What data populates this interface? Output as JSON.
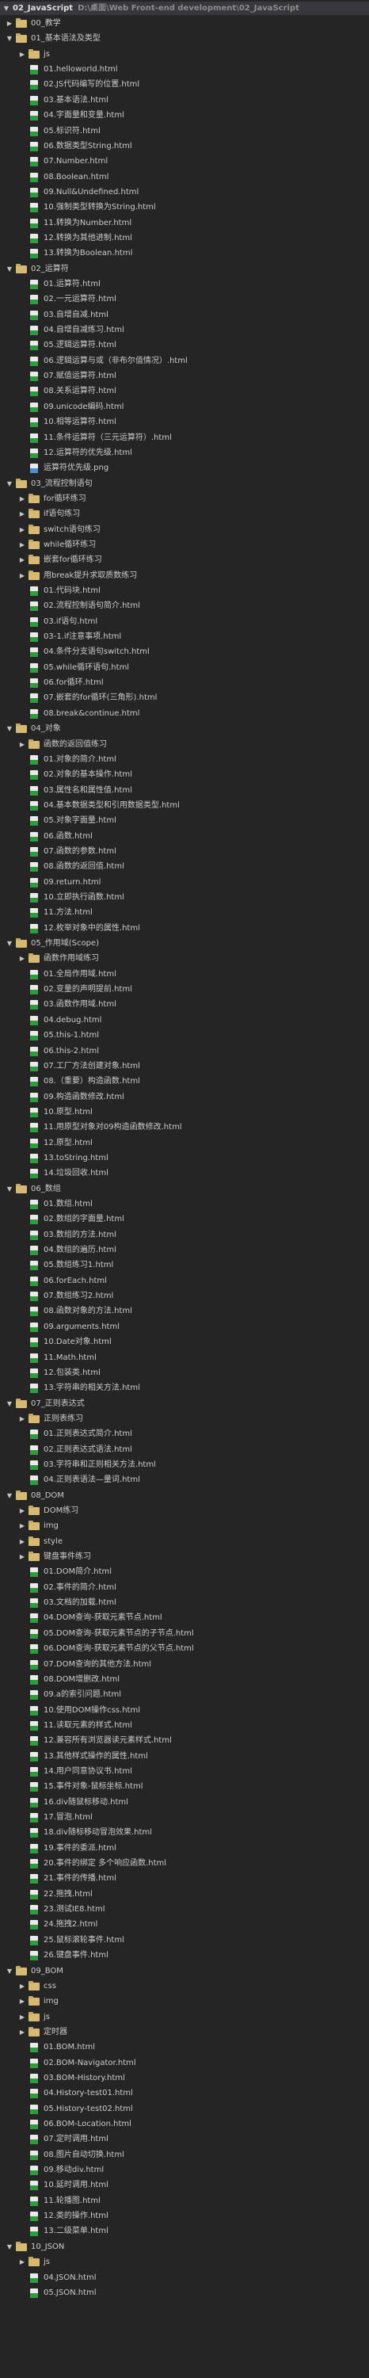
{
  "root": {
    "label": "02_JavaScript",
    "path": "D:\\桌面\\Web Front-end development\\02_JavaScript"
  },
  "items": [
    {
      "d": 1,
      "t": "folder",
      "n": "00_教学",
      "o": false
    },
    {
      "d": 1,
      "t": "folder",
      "n": "01_基本语法及类型",
      "o": true
    },
    {
      "d": 2,
      "t": "folder",
      "n": "js",
      "o": false
    },
    {
      "d": 2,
      "t": "html",
      "n": "01.helloworld.html"
    },
    {
      "d": 2,
      "t": "html",
      "n": "02.JS代码编写的位置.html"
    },
    {
      "d": 2,
      "t": "html",
      "n": "03.基本语法.html"
    },
    {
      "d": 2,
      "t": "html",
      "n": "04.字面量和变量.html"
    },
    {
      "d": 2,
      "t": "html",
      "n": "05.标识符.html"
    },
    {
      "d": 2,
      "t": "html",
      "n": "06.数据类型String.html"
    },
    {
      "d": 2,
      "t": "html",
      "n": "07.Number.html"
    },
    {
      "d": 2,
      "t": "html",
      "n": "08.Boolean.html"
    },
    {
      "d": 2,
      "t": "html",
      "n": "09.Null&Undefined.html"
    },
    {
      "d": 2,
      "t": "html",
      "n": "10.强制类型转换为String.html"
    },
    {
      "d": 2,
      "t": "html",
      "n": "11.转换为Number.html"
    },
    {
      "d": 2,
      "t": "html",
      "n": "12.转换为其他进制.html"
    },
    {
      "d": 2,
      "t": "html",
      "n": "13.转换为Boolean.html"
    },
    {
      "d": 1,
      "t": "folder",
      "n": "02_运算符",
      "o": true
    },
    {
      "d": 2,
      "t": "html",
      "n": "01.运算符.html"
    },
    {
      "d": 2,
      "t": "html",
      "n": "02.一元运算符.html"
    },
    {
      "d": 2,
      "t": "html",
      "n": "03.自增自减.html"
    },
    {
      "d": 2,
      "t": "html",
      "n": "04.自增自减练习.html"
    },
    {
      "d": 2,
      "t": "html",
      "n": "05.逻辑运算符.html"
    },
    {
      "d": 2,
      "t": "html",
      "n": "06.逻辑运算与或（非布尔值情况）.html"
    },
    {
      "d": 2,
      "t": "html",
      "n": "07.赋值运算符.html"
    },
    {
      "d": 2,
      "t": "html",
      "n": "08.关系运算符.html"
    },
    {
      "d": 2,
      "t": "html",
      "n": "09.unicode编码.html"
    },
    {
      "d": 2,
      "t": "html",
      "n": "10.相等运算符.html"
    },
    {
      "d": 2,
      "t": "html",
      "n": "11.条件运算符（三元运算符）.html"
    },
    {
      "d": 2,
      "t": "html",
      "n": "12.运算符的优先级.html"
    },
    {
      "d": 2,
      "t": "png",
      "n": "运算符优先级.png"
    },
    {
      "d": 1,
      "t": "folder",
      "n": "03_流程控制语句",
      "o": true
    },
    {
      "d": 2,
      "t": "folder",
      "n": "for循环练习",
      "o": false
    },
    {
      "d": 2,
      "t": "folder",
      "n": "if语句练习",
      "o": false
    },
    {
      "d": 2,
      "t": "folder",
      "n": "switch语句练习",
      "o": false
    },
    {
      "d": 2,
      "t": "folder",
      "n": "while循环练习",
      "o": false
    },
    {
      "d": 2,
      "t": "folder",
      "n": "嵌套for循环练习",
      "o": false
    },
    {
      "d": 2,
      "t": "folder",
      "n": "用break提升求取质数练习",
      "o": false
    },
    {
      "d": 2,
      "t": "html",
      "n": "01.代码块.html"
    },
    {
      "d": 2,
      "t": "html",
      "n": "02.流程控制语句简介.html"
    },
    {
      "d": 2,
      "t": "html",
      "n": "03.if语句.html"
    },
    {
      "d": 2,
      "t": "html",
      "n": "03-1.if注意事项.html"
    },
    {
      "d": 2,
      "t": "html",
      "n": "04.条件分支语句switch.html"
    },
    {
      "d": 2,
      "t": "html",
      "n": "05.while循环语句.html"
    },
    {
      "d": 2,
      "t": "html",
      "n": "06.for循环.html"
    },
    {
      "d": 2,
      "t": "html",
      "n": "07.嵌套的for循环(三角形).html"
    },
    {
      "d": 2,
      "t": "html",
      "n": "08.break&continue.html"
    },
    {
      "d": 1,
      "t": "folder",
      "n": "04_对象",
      "o": true
    },
    {
      "d": 2,
      "t": "folder",
      "n": "函数的返回值练习",
      "o": false
    },
    {
      "d": 2,
      "t": "html",
      "n": "01.对象的简介.html"
    },
    {
      "d": 2,
      "t": "html",
      "n": "02.对象的基本操作.html"
    },
    {
      "d": 2,
      "t": "html",
      "n": "03.属性名和属性值.html"
    },
    {
      "d": 2,
      "t": "html",
      "n": "04.基本数据类型和引用数据类型.html"
    },
    {
      "d": 2,
      "t": "html",
      "n": "05.对象字面量.html"
    },
    {
      "d": 2,
      "t": "html",
      "n": "06.函数.html"
    },
    {
      "d": 2,
      "t": "html",
      "n": "07.函数的参数.html"
    },
    {
      "d": 2,
      "t": "html",
      "n": "08.函数的返回值.html"
    },
    {
      "d": 2,
      "t": "html",
      "n": "09.return.html"
    },
    {
      "d": 2,
      "t": "html",
      "n": "10.立即执行函数.html"
    },
    {
      "d": 2,
      "t": "html",
      "n": "11.方法.html"
    },
    {
      "d": 2,
      "t": "html",
      "n": "12.枚举对象中的属性.html"
    },
    {
      "d": 1,
      "t": "folder",
      "n": "05_作用域(Scope)",
      "o": true
    },
    {
      "d": 2,
      "t": "folder",
      "n": "函数作用域练习",
      "o": false
    },
    {
      "d": 2,
      "t": "html",
      "n": "01.全局作用域.html"
    },
    {
      "d": 2,
      "t": "html",
      "n": "02.变量的声明提前.html"
    },
    {
      "d": 2,
      "t": "html",
      "n": "03.函数作用域.html"
    },
    {
      "d": 2,
      "t": "html",
      "n": "04.debug.html"
    },
    {
      "d": 2,
      "t": "html",
      "n": "05.this-1.html"
    },
    {
      "d": 2,
      "t": "html",
      "n": "06.this-2.html"
    },
    {
      "d": 2,
      "t": "html",
      "n": "07.工厂方法创建对象.html"
    },
    {
      "d": 2,
      "t": "html",
      "n": "08.（重要）构造函数.html"
    },
    {
      "d": 2,
      "t": "html",
      "n": "09.构造函数修改.html"
    },
    {
      "d": 2,
      "t": "html",
      "n": "10.原型.html"
    },
    {
      "d": 2,
      "t": "html",
      "n": "11.用原型对象对09构造函数修改.html"
    },
    {
      "d": 2,
      "t": "html",
      "n": "12.原型.html"
    },
    {
      "d": 2,
      "t": "html",
      "n": "13.toString.html"
    },
    {
      "d": 2,
      "t": "html",
      "n": "14.垃圾回收.html"
    },
    {
      "d": 1,
      "t": "folder",
      "n": "06_数组",
      "o": true
    },
    {
      "d": 2,
      "t": "html",
      "n": "01.数组.html"
    },
    {
      "d": 2,
      "t": "html",
      "n": "02.数组的字面量.html"
    },
    {
      "d": 2,
      "t": "html",
      "n": "03.数组的方法.html"
    },
    {
      "d": 2,
      "t": "html",
      "n": "04.数组的遍历.html"
    },
    {
      "d": 2,
      "t": "html",
      "n": "05.数组练习1.html"
    },
    {
      "d": 2,
      "t": "html",
      "n": "06.forEach.html"
    },
    {
      "d": 2,
      "t": "html",
      "n": "07.数组练习2.html"
    },
    {
      "d": 2,
      "t": "html",
      "n": "08.函数对象的方法.html"
    },
    {
      "d": 2,
      "t": "html",
      "n": "09.arguments.html"
    },
    {
      "d": 2,
      "t": "html",
      "n": "10.Date对象.html"
    },
    {
      "d": 2,
      "t": "html",
      "n": "11.Math.html"
    },
    {
      "d": 2,
      "t": "html",
      "n": "12.包装类.html"
    },
    {
      "d": 2,
      "t": "html",
      "n": "13.字符串的相关方法.html"
    },
    {
      "d": 1,
      "t": "folder",
      "n": "07_正则表达式",
      "o": true
    },
    {
      "d": 2,
      "t": "folder",
      "n": "正则表练习",
      "o": false
    },
    {
      "d": 2,
      "t": "html",
      "n": "01.正则表达式简介.html"
    },
    {
      "d": 2,
      "t": "html",
      "n": "02.正则表达式语法.html"
    },
    {
      "d": 2,
      "t": "html",
      "n": "03.字符串和正则相关方法.html"
    },
    {
      "d": 2,
      "t": "html",
      "n": "04.正则表语法—量词.html"
    },
    {
      "d": 1,
      "t": "folder",
      "n": "08_DOM",
      "o": true
    },
    {
      "d": 2,
      "t": "folder",
      "n": "DOM练习",
      "o": false
    },
    {
      "d": 2,
      "t": "folder",
      "n": "img",
      "o": false
    },
    {
      "d": 2,
      "t": "folder",
      "n": "style",
      "o": false
    },
    {
      "d": 2,
      "t": "folder",
      "n": "键盘事件练习",
      "o": false
    },
    {
      "d": 2,
      "t": "html",
      "n": "01.DOM简介.html"
    },
    {
      "d": 2,
      "t": "html",
      "n": "02.事件的简介.html"
    },
    {
      "d": 2,
      "t": "html",
      "n": "03.文档的加载.html"
    },
    {
      "d": 2,
      "t": "html",
      "n": "04.DOM查询-获取元素节点.html"
    },
    {
      "d": 2,
      "t": "html",
      "n": "05.DOM查询-获取元素节点的子节点.html"
    },
    {
      "d": 2,
      "t": "html",
      "n": "06.DOM查询-获取元素节点的父节点.html"
    },
    {
      "d": 2,
      "t": "html",
      "n": "07.DOM查询的其他方法.html"
    },
    {
      "d": 2,
      "t": "html",
      "n": "08.DOM增删改.html"
    },
    {
      "d": 2,
      "t": "html",
      "n": "09.a的索引问题.html"
    },
    {
      "d": 2,
      "t": "html",
      "n": "10.使用DOM操作css.html"
    },
    {
      "d": 2,
      "t": "html",
      "n": "11.读取元素的样式.html"
    },
    {
      "d": 2,
      "t": "html",
      "n": "12.兼容所有浏览器读元素样式.html"
    },
    {
      "d": 2,
      "t": "html",
      "n": "13.其他样式操作的属性.html"
    },
    {
      "d": 2,
      "t": "html",
      "n": "14.用户同意协议书.html"
    },
    {
      "d": 2,
      "t": "html",
      "n": "15.事件对象-鼠标坐标.html"
    },
    {
      "d": 2,
      "t": "html",
      "n": "16.div随鼠标移动.html"
    },
    {
      "d": 2,
      "t": "html",
      "n": "17.冒泡.html"
    },
    {
      "d": 2,
      "t": "html",
      "n": "18.div随标移动冒泡效果.html"
    },
    {
      "d": 2,
      "t": "html",
      "n": "19.事件的委派.html"
    },
    {
      "d": 2,
      "t": "html",
      "n": "20.事件的绑定 多个响应函数.html"
    },
    {
      "d": 2,
      "t": "html",
      "n": "21.事件的传播.html"
    },
    {
      "d": 2,
      "t": "html",
      "n": "22.拖拽.html"
    },
    {
      "d": 2,
      "t": "html",
      "n": "23.测试IE8.html"
    },
    {
      "d": 2,
      "t": "html",
      "n": "24.拖拽2.html"
    },
    {
      "d": 2,
      "t": "html",
      "n": "25.鼠标滚轮事件.html"
    },
    {
      "d": 2,
      "t": "html",
      "n": "26.键盘事件.html"
    },
    {
      "d": 1,
      "t": "folder",
      "n": "09_BOM",
      "o": true
    },
    {
      "d": 2,
      "t": "folder",
      "n": "css",
      "o": false
    },
    {
      "d": 2,
      "t": "folder",
      "n": "img",
      "o": false
    },
    {
      "d": 2,
      "t": "folder",
      "n": "js",
      "o": false
    },
    {
      "d": 2,
      "t": "folder",
      "n": "定时器",
      "o": false
    },
    {
      "d": 2,
      "t": "html",
      "n": "01.BOM.html"
    },
    {
      "d": 2,
      "t": "html",
      "n": "02.BOM-Navigator.html"
    },
    {
      "d": 2,
      "t": "html",
      "n": "03.BOM-History.html"
    },
    {
      "d": 2,
      "t": "html",
      "n": "04.History-test01.html"
    },
    {
      "d": 2,
      "t": "html",
      "n": "05.History-test02.html"
    },
    {
      "d": 2,
      "t": "html",
      "n": "06.BOM-Location.html"
    },
    {
      "d": 2,
      "t": "html",
      "n": "07.定时调用.html"
    },
    {
      "d": 2,
      "t": "html",
      "n": "08.图片自动切换.html"
    },
    {
      "d": 2,
      "t": "html",
      "n": "09.移动div.html"
    },
    {
      "d": 2,
      "t": "html",
      "n": "10.延时调用.html"
    },
    {
      "d": 2,
      "t": "html",
      "n": "11.轮播图.html"
    },
    {
      "d": 2,
      "t": "html",
      "n": "12.类的操作.html"
    },
    {
      "d": 2,
      "t": "html",
      "n": "13.二级菜单.html"
    },
    {
      "d": 1,
      "t": "folder",
      "n": "10_JSON",
      "o": true
    },
    {
      "d": 2,
      "t": "folder",
      "n": "js",
      "o": false
    },
    {
      "d": 2,
      "t": "html",
      "n": "04.JSON.html"
    },
    {
      "d": 2,
      "t": "html",
      "n": "05.JSON.html"
    }
  ]
}
